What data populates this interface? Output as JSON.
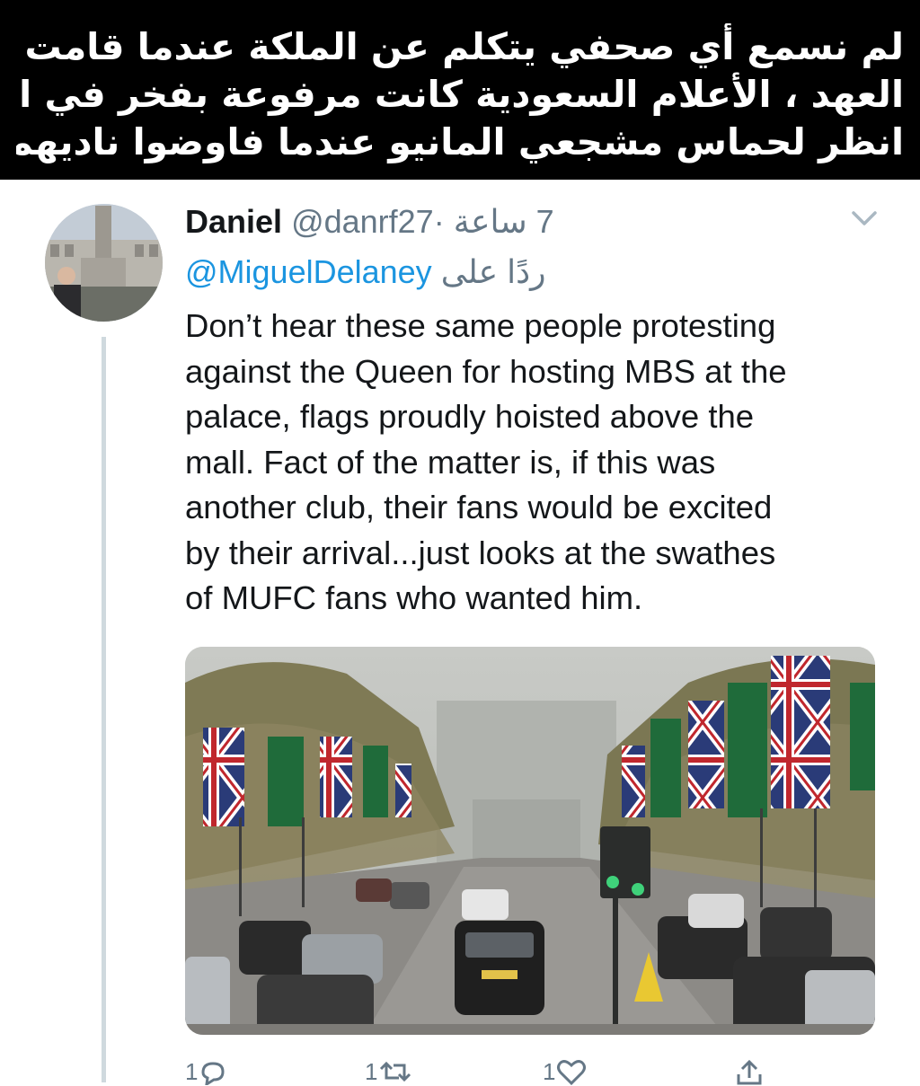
{
  "caption": {
    "lines": [
      "لم نسمع أي صحفي يتكلم عن الملكة عندما قامت باستقبال ولي",
      "العهد ، الأعلام السعودية كانت مرفوعة بفخر في الأعلا ، فقط",
      "انظر لحماس مشجعي المانيو عندما فاوضوا ناديهم"
    ]
  },
  "tweet": {
    "author_name": "Daniel",
    "author_handle": "@danrf27",
    "separator": "·",
    "time": "7 ساعة",
    "reply_prefix": "ردًا على",
    "reply_to": "@MiguelDelaney",
    "body_lines": [
      "Don’t hear these same people protesting",
      "against the Queen for hosting MBS at the",
      "palace, flags proudly hoisted above the",
      "mall. Fact of the matter is, if this was",
      "another club, their fans would be excited",
      "by their arrival...just looks at the swathes",
      "of MUFC fans who wanted him."
    ],
    "actions": {
      "reply_count": "1",
      "retweet_count": "1",
      "like_count": "1"
    }
  },
  "icons": [
    "chevron-down-icon",
    "reply-icon",
    "retweet-icon",
    "like-icon",
    "share-icon"
  ],
  "colors": {
    "caption_bg": "#000000",
    "caption_text": "#ffffff",
    "link": "#1b95e0",
    "muted": "#657786",
    "text": "#14171a",
    "thread_line": "#cfd9de",
    "flag_green": "#1f6b3a"
  }
}
